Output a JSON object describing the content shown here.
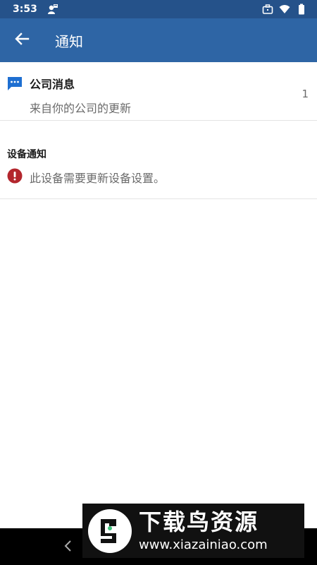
{
  "status_bar": {
    "time": "3:53",
    "icons": [
      "managed-profile-icon",
      "work-briefcase-icon",
      "wifi-icon",
      "battery-icon"
    ]
  },
  "app_bar": {
    "title": "通知",
    "back_icon": "arrow-left-icon"
  },
  "company_messages": {
    "title": "公司消息",
    "subtitle": "来自你的公司的更新",
    "count": "1",
    "icon": "chat-bubble-icon"
  },
  "device_notifications": {
    "header": "设备通知",
    "items": [
      {
        "text": "此设备需要更新设备设置。",
        "icon": "error-icon"
      }
    ]
  },
  "watermark": {
    "title": "下载鸟资源",
    "url": "www.xiazainiao.com"
  },
  "colors": {
    "status_bar": "#25528a",
    "app_bar": "#2e65a5",
    "accent_blue": "#1e6fd1",
    "error_red": "#b3262d"
  }
}
